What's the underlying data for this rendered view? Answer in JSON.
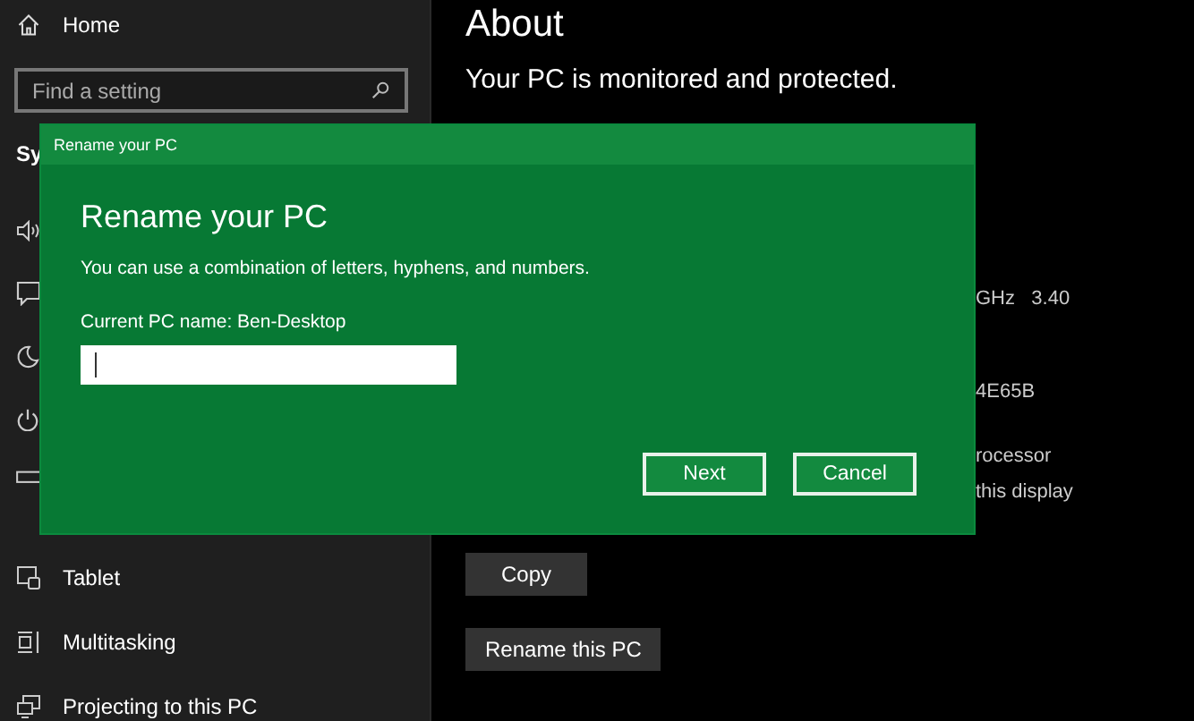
{
  "sidebar": {
    "home": "Home",
    "search": {
      "placeholder": "Find a setting"
    },
    "section": "Sy",
    "items": [
      {
        "label": "Tablet"
      },
      {
        "label": "Multitasking"
      },
      {
        "label": "Projecting to this PC"
      }
    ]
  },
  "main": {
    "title": "About",
    "status": "Your PC is monitored and protected.",
    "specs": [
      {
        "text": "GHz   3.40"
      },
      {
        "text": "4E65B"
      },
      {
        "text": "rocessor"
      },
      {
        "text": "this display"
      }
    ],
    "buttons": [
      "Copy",
      "Rename this PC"
    ]
  },
  "dialog": {
    "title": "Rename your PC",
    "heading": "Rename your PC",
    "description": "You can use a combination of letters, hyphens, and numbers.",
    "current_name": "Current PC name: Ben-Desktop",
    "buttons": [
      "Next",
      "Cancel"
    ]
  }
}
